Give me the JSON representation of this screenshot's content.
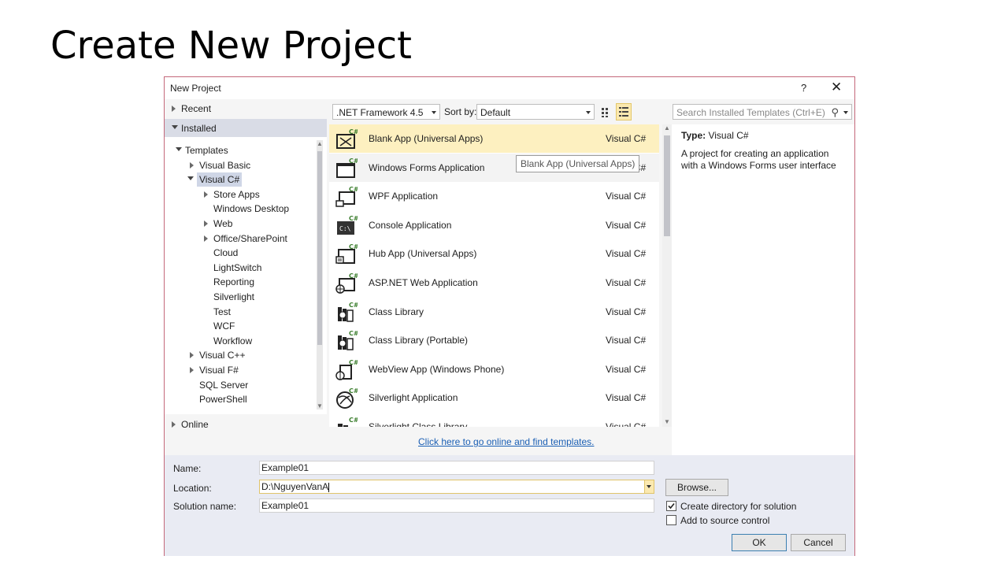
{
  "slide": {
    "title": "Create New Project"
  },
  "dialog": {
    "title": "New Project",
    "help": "?",
    "close": "✕",
    "left": {
      "recent": "Recent",
      "installed": "Installed",
      "online": "Online",
      "tree": [
        {
          "label": "Templates",
          "level": 0,
          "arrow": "down"
        },
        {
          "label": "Visual Basic",
          "level": 1,
          "arrow": "right"
        },
        {
          "label": "Visual C#",
          "level": 1,
          "arrow": "down",
          "selected": true
        },
        {
          "label": "Store Apps",
          "level": 2,
          "arrow": "right"
        },
        {
          "label": "Windows Desktop",
          "level": 2,
          "arrow": ""
        },
        {
          "label": "Web",
          "level": 2,
          "arrow": "right"
        },
        {
          "label": "Office/SharePoint",
          "level": 2,
          "arrow": "right"
        },
        {
          "label": "Cloud",
          "level": 2,
          "arrow": ""
        },
        {
          "label": "LightSwitch",
          "level": 2,
          "arrow": ""
        },
        {
          "label": "Reporting",
          "level": 2,
          "arrow": ""
        },
        {
          "label": "Silverlight",
          "level": 2,
          "arrow": ""
        },
        {
          "label": "Test",
          "level": 2,
          "arrow": ""
        },
        {
          "label": "WCF",
          "level": 2,
          "arrow": ""
        },
        {
          "label": "Workflow",
          "level": 2,
          "arrow": ""
        },
        {
          "label": "Visual C++",
          "level": 1,
          "arrow": "right"
        },
        {
          "label": "Visual F#",
          "level": 1,
          "arrow": "right"
        },
        {
          "label": "SQL Server",
          "level": 1,
          "arrow": ""
        },
        {
          "label": "PowerShell",
          "level": 1,
          "arrow": ""
        }
      ]
    },
    "toolbar": {
      "framework": ".NET Framework 4.5",
      "sort_label": "Sort by:",
      "sort_value": "Default",
      "search_placeholder": "Search Installed Templates (Ctrl+E)"
    },
    "templates": [
      {
        "name": "Blank App (Universal Apps)",
        "lang": "Visual C#",
        "icon": "blank-app-icon",
        "state": "selected"
      },
      {
        "name": "Windows Forms Application",
        "lang": "Visual C#",
        "icon": "windows-forms-icon",
        "state": "hover"
      },
      {
        "name": "WPF Application",
        "lang": "Visual C#",
        "icon": "wpf-app-icon",
        "state": ""
      },
      {
        "name": "Console Application",
        "lang": "Visual C#",
        "icon": "console-app-icon",
        "state": ""
      },
      {
        "name": "Hub App (Universal Apps)",
        "lang": "Visual C#",
        "icon": "hub-app-icon",
        "state": ""
      },
      {
        "name": "ASP.NET Web Application",
        "lang": "Visual C#",
        "icon": "aspnet-web-icon",
        "state": ""
      },
      {
        "name": "Class Library",
        "lang": "Visual C#",
        "icon": "class-library-icon",
        "state": ""
      },
      {
        "name": "Class Library (Portable)",
        "lang": "Visual C#",
        "icon": "class-library-portable-icon",
        "state": ""
      },
      {
        "name": "WebView App (Windows Phone)",
        "lang": "Visual C#",
        "icon": "webview-app-icon",
        "state": ""
      },
      {
        "name": "Silverlight Application",
        "lang": "Visual C#",
        "icon": "silverlight-app-icon",
        "state": ""
      },
      {
        "name": "Silverlight Class Library",
        "lang": "Visual C#",
        "icon": "silverlight-class-library-icon",
        "state": ""
      }
    ],
    "tooltip": "Blank App (Universal Apps)",
    "online_link": "Click here to go online and find templates.",
    "description": {
      "type_label": "Type:",
      "type_value": "Visual C#",
      "text": "A project for creating an application with a Windows Forms user interface"
    },
    "form": {
      "name_label": "Name:",
      "name_value": "Example01",
      "location_label": "Location:",
      "location_value": "D:\\NguyenVanA",
      "solution_label": "Solution name:",
      "solution_value": "Example01",
      "browse": "Browse...",
      "create_dir": "Create directory for solution",
      "create_dir_checked": true,
      "source_control": "Add to source control",
      "source_control_checked": false,
      "ok": "OK",
      "cancel": "Cancel"
    }
  }
}
